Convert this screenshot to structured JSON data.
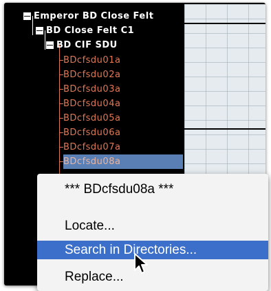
{
  "tree": {
    "root": {
      "label": "Emperor BD Close Felt"
    },
    "child": {
      "label": "BD Close Felt C1"
    },
    "grandchild": {
      "label": "BD CIF SDU"
    },
    "leaves": [
      {
        "label": "BDcfsdu01a"
      },
      {
        "label": "BDcfsdu02a"
      },
      {
        "label": "BDcfsdu03a"
      },
      {
        "label": "BDcfsdu04a"
      },
      {
        "label": "BDcfsdu05a"
      },
      {
        "label": "BDcfsdu06a"
      },
      {
        "label": "BDcfsdu07a"
      },
      {
        "label": "BDcfsdu08a",
        "selected": true
      }
    ]
  },
  "context_menu": {
    "title": "*** BDcfsdu08a ***",
    "items": [
      {
        "label": "Locate..."
      },
      {
        "label": "Search in Directories...",
        "highlighted": true
      },
      {
        "label": "Replace..."
      }
    ]
  },
  "icons": {
    "toggle": "collapse-toggle-icon",
    "cursor": "arrow-pointer-icon"
  },
  "colors": {
    "tree_background": "#000000",
    "parent_label": "#ffffff",
    "leaf_label": "#e07856",
    "selection": "#5a7fb5",
    "menu_background": "#f3f3f3",
    "menu_highlight": "#3c6fc9",
    "grid_background": "#e5ebee"
  }
}
